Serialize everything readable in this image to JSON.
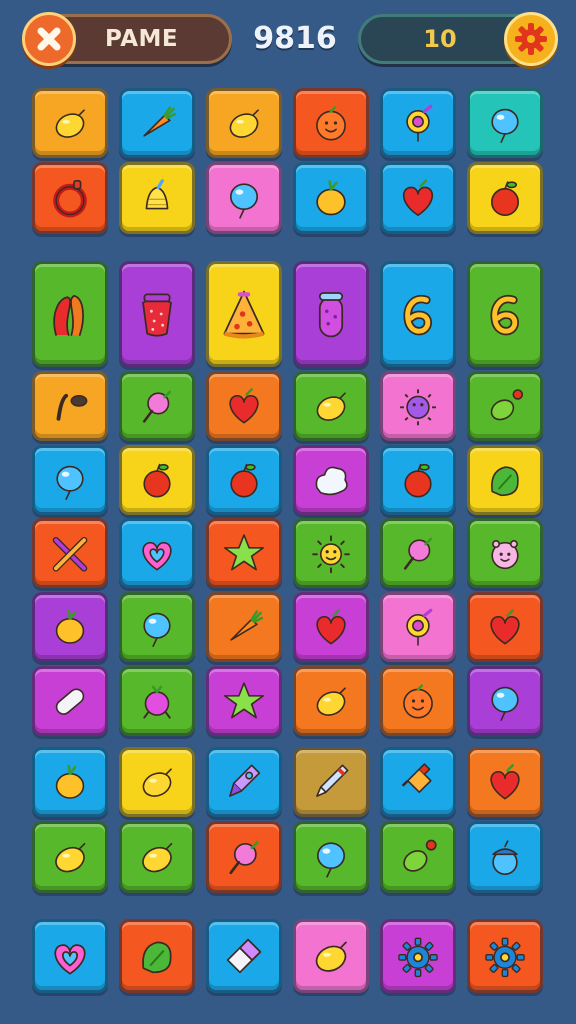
{
  "hud": {
    "left_label": "PAME",
    "score": "9816",
    "counter": "10"
  },
  "rows": [
    [
      {
        "color": "#f6a623",
        "icon": "lemon"
      },
      {
        "color": "#1ba8e8",
        "icon": "carrot"
      },
      {
        "color": "#f6a623",
        "icon": "lemon"
      },
      {
        "color": "#f4571f",
        "icon": "orange-face"
      },
      {
        "color": "#1ba8e8",
        "icon": "ring-pin"
      },
      {
        "color": "#25c4b8",
        "icon": "balloon"
      }
    ],
    [
      {
        "color": "#f4571f",
        "icon": "ring"
      },
      {
        "color": "#f7d41a",
        "icon": "bell"
      },
      {
        "color": "#f274d0",
        "icon": "balloon"
      },
      {
        "color": "#1ba8e8",
        "icon": "onion"
      },
      {
        "color": "#1ba8e8",
        "icon": "heart"
      },
      {
        "color": "#f7d41a",
        "icon": "apple"
      }
    ],
    [
      {
        "color": "#56b82a",
        "icon": "ribbon"
      },
      {
        "color": "#a93fd6",
        "icon": "strawberry"
      },
      {
        "color": "#f7d41a",
        "icon": "pizza"
      },
      {
        "color": "#a93fd6",
        "icon": "pickle"
      },
      {
        "color": "#1ba8e8",
        "icon": "number-six"
      },
      {
        "color": "#56b82a",
        "icon": "number-six"
      }
    ],
    [
      {
        "color": "#f6a623",
        "icon": "pipe"
      },
      {
        "color": "#56b82a",
        "icon": "lollipop"
      },
      {
        "color": "#f4781f",
        "icon": "heart"
      },
      {
        "color": "#56b82a",
        "icon": "lemon"
      },
      {
        "color": "#f274d0",
        "icon": "virus"
      },
      {
        "color": "#56b82a",
        "icon": "pea"
      }
    ],
    [
      {
        "color": "#1ba8e8",
        "icon": "balloon"
      },
      {
        "color": "#f7d41a",
        "icon": "apple"
      },
      {
        "color": "#1ba8e8",
        "icon": "apple"
      },
      {
        "color": "#c83fd6",
        "icon": "cloud"
      },
      {
        "color": "#1ba8e8",
        "icon": "apple"
      },
      {
        "color": "#f7d41a",
        "icon": "leaf"
      }
    ],
    [
      {
        "color": "#f4571f",
        "icon": "cross-tools"
      },
      {
        "color": "#1ba8e8",
        "icon": "heart-outline"
      },
      {
        "color": "#f4571f",
        "icon": "star"
      },
      {
        "color": "#56b82a",
        "icon": "sun"
      },
      {
        "color": "#56b82a",
        "icon": "lollipop"
      },
      {
        "color": "#56b82a",
        "icon": "face"
      }
    ],
    [
      {
        "color": "#a93fd6",
        "icon": "onion"
      },
      {
        "color": "#56b82a",
        "icon": "balloon"
      },
      {
        "color": "#f4781f",
        "icon": "carrot"
      },
      {
        "color": "#c83fd6",
        "icon": "heart"
      },
      {
        "color": "#f274d0",
        "icon": "ring-pin"
      },
      {
        "color": "#f4571f",
        "icon": "heart"
      }
    ],
    [
      {
        "color": "#c83fd6",
        "icon": "capsule"
      },
      {
        "color": "#56b82a",
        "icon": "berry"
      },
      {
        "color": "#c83fd6",
        "icon": "star"
      },
      {
        "color": "#f4781f",
        "icon": "lemon"
      },
      {
        "color": "#f4781f",
        "icon": "orange-face"
      },
      {
        "color": "#a93fd6",
        "icon": "balloon"
      }
    ],
    [
      {
        "color": "#1ba8e8",
        "icon": "onion"
      },
      {
        "color": "#f7d41a",
        "icon": "lemon"
      },
      {
        "color": "#1ba8e8",
        "icon": "rocket"
      },
      {
        "color": "#c49a3a",
        "icon": "pen"
      },
      {
        "color": "#1ba8e8",
        "icon": "bottle"
      },
      {
        "color": "#f4781f",
        "icon": "heart"
      }
    ],
    [
      {
        "color": "#56b82a",
        "icon": "lemon"
      },
      {
        "color": "#56b82a",
        "icon": "lemon"
      },
      {
        "color": "#f4571f",
        "icon": "lollipop"
      },
      {
        "color": "#56b82a",
        "icon": "balloon"
      },
      {
        "color": "#56b82a",
        "icon": "pea"
      },
      {
        "color": "#1ba8e8",
        "icon": "acorn"
      }
    ]
  ],
  "bottom_row": [
    {
      "color": "#1ba8e8",
      "icon": "heart-outline"
    },
    {
      "color": "#f4571f",
      "icon": "leaf"
    },
    {
      "color": "#1ba8e8",
      "icon": "eraser"
    },
    {
      "color": "#f274d0",
      "icon": "lemon"
    },
    {
      "color": "#c83fd6",
      "icon": "gear"
    },
    {
      "color": "#f4571f",
      "icon": "gear"
    }
  ]
}
